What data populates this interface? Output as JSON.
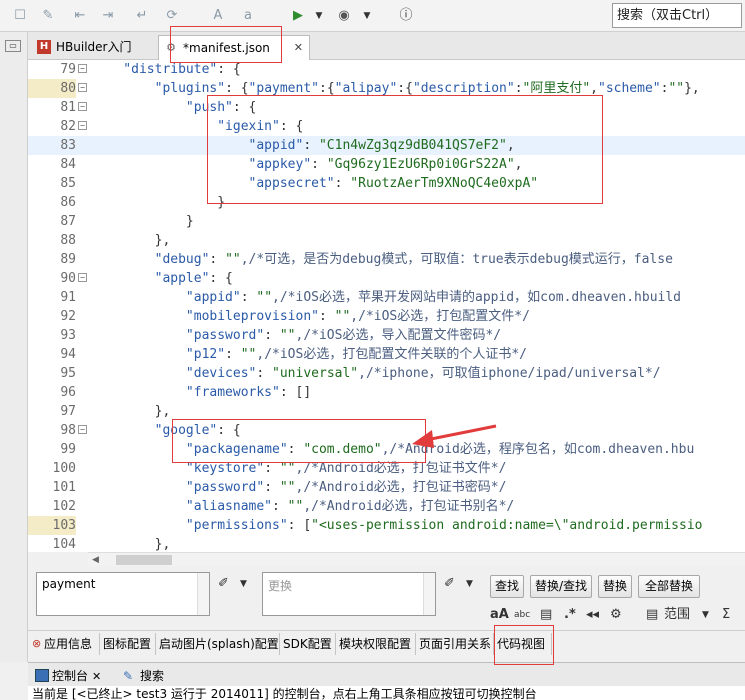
{
  "search": {
    "placeholder": "搜索（双击Ctrl）"
  },
  "tabs": [
    {
      "label": "HBuilder入门",
      "icon": "hbuilder-logo-icon",
      "icon_text": "H"
    },
    {
      "label": "*manifest.json",
      "icon": "gear-icon",
      "icon_text": "⚙",
      "close": "✕"
    }
  ],
  "lines": [
    {
      "num": "79",
      "fold": true,
      "segs": [
        {
          "t": "    \"distribute\"",
          "c": "k"
        },
        {
          "t": ": {",
          "c": "p"
        }
      ]
    },
    {
      "num": "80",
      "fold": true,
      "current": true,
      "segs": [
        {
          "t": "        \"plugins\"",
          "c": "k"
        },
        {
          "t": ": {",
          "c": "p"
        },
        {
          "t": "\"payment\"",
          "c": "k"
        },
        {
          "t": ":{",
          "c": "p"
        },
        {
          "t": "\"alipay\"",
          "c": "k"
        },
        {
          "t": ":{",
          "c": "p"
        },
        {
          "t": "\"description\"",
          "c": "k"
        },
        {
          "t": ":",
          "c": "p"
        },
        {
          "t": "\"阿里支付\"",
          "c": "s"
        },
        {
          "t": ",",
          "c": "p"
        },
        {
          "t": "\"scheme\"",
          "c": "k"
        },
        {
          "t": ":",
          "c": "p"
        },
        {
          "t": "\"\"",
          "c": "s"
        },
        {
          "t": "},",
          "c": "p"
        }
      ]
    },
    {
      "num": "81",
      "fold": true,
      "segs": [
        {
          "t": "            \"push\"",
          "c": "k"
        },
        {
          "t": ": {",
          "c": "p"
        }
      ]
    },
    {
      "num": "82",
      "fold": true,
      "segs": [
        {
          "t": "                \"igexin\"",
          "c": "k"
        },
        {
          "t": ": {",
          "c": "p"
        }
      ]
    },
    {
      "num": "83",
      "highlight": true,
      "segs": [
        {
          "t": "                    \"appid\"",
          "c": "k"
        },
        {
          "t": ": ",
          "c": "p"
        },
        {
          "t": "\"C1n4wZg3qz9dB041QS7eF2\"",
          "c": "s"
        },
        {
          "t": ",",
          "c": "p"
        }
      ]
    },
    {
      "num": "84",
      "segs": [
        {
          "t": "                    \"appkey\"",
          "c": "k"
        },
        {
          "t": ": ",
          "c": "p"
        },
        {
          "t": "\"Gq96zy1EzU6Rp0i0GrS22A\"",
          "c": "s"
        },
        {
          "t": ",",
          "c": "p"
        }
      ]
    },
    {
      "num": "85",
      "segs": [
        {
          "t": "                    \"appsecret\"",
          "c": "k"
        },
        {
          "t": ": ",
          "c": "p"
        },
        {
          "t": "\"RuotzAerTm9XNoQC4e0xpA\"",
          "c": "s"
        }
      ]
    },
    {
      "num": "86",
      "segs": [
        {
          "t": "                }",
          "c": "p"
        }
      ]
    },
    {
      "num": "87",
      "segs": [
        {
          "t": "            }",
          "c": "p"
        }
      ]
    },
    {
      "num": "88",
      "segs": [
        {
          "t": "        },",
          "c": "p"
        }
      ]
    },
    {
      "num": "89",
      "segs": [
        {
          "t": "        \"debug\"",
          "c": "k"
        },
        {
          "t": ": ",
          "c": "p"
        },
        {
          "t": "\"\"",
          "c": "s"
        },
        {
          "t": ",/*可选，是否为debug模式，可取值：true表示debug模式运行，false",
          "c": "c"
        }
      ]
    },
    {
      "num": "90",
      "fold": true,
      "segs": [
        {
          "t": "        \"apple\"",
          "c": "k"
        },
        {
          "t": ": {",
          "c": "p"
        }
      ]
    },
    {
      "num": "91",
      "segs": [
        {
          "t": "            \"appid\"",
          "c": "k"
        },
        {
          "t": ": ",
          "c": "p"
        },
        {
          "t": "\"\"",
          "c": "s"
        },
        {
          "t": ",/*iOS必选，苹果开发网站申请的appid，如com.dheaven.hbuild",
          "c": "c"
        }
      ]
    },
    {
      "num": "92",
      "segs": [
        {
          "t": "            \"mobileprovision\"",
          "c": "k"
        },
        {
          "t": ": ",
          "c": "p"
        },
        {
          "t": "\"\"",
          "c": "s"
        },
        {
          "t": ",/*iOS必选，打包配置文件*/",
          "c": "c"
        }
      ]
    },
    {
      "num": "93",
      "segs": [
        {
          "t": "            \"password\"",
          "c": "k"
        },
        {
          "t": ": ",
          "c": "p"
        },
        {
          "t": "\"\"",
          "c": "s"
        },
        {
          "t": ",/*iOS必选，导入配置文件密码*/",
          "c": "c"
        }
      ]
    },
    {
      "num": "94",
      "segs": [
        {
          "t": "            \"p12\"",
          "c": "k"
        },
        {
          "t": ": ",
          "c": "p"
        },
        {
          "t": "\"\"",
          "c": "s"
        },
        {
          "t": ",/*iOS必选，打包配置文件关联的个人证书*/",
          "c": "c"
        }
      ]
    },
    {
      "num": "95",
      "segs": [
        {
          "t": "            \"devices\"",
          "c": "k"
        },
        {
          "t": ": ",
          "c": "p"
        },
        {
          "t": "\"universal\"",
          "c": "s"
        },
        {
          "t": ",/*iphone，可取值iphone/ipad/universal*/",
          "c": "c"
        }
      ]
    },
    {
      "num": "96",
      "segs": [
        {
          "t": "            \"frameworks\"",
          "c": "k"
        },
        {
          "t": ": []",
          "c": "p"
        }
      ]
    },
    {
      "num": "97",
      "segs": [
        {
          "t": "        },",
          "c": "p"
        }
      ]
    },
    {
      "num": "98",
      "fold": true,
      "segs": [
        {
          "t": "        \"google\"",
          "c": "k"
        },
        {
          "t": ": {",
          "c": "p"
        }
      ]
    },
    {
      "num": "99",
      "segs": [
        {
          "t": "            \"packagename\"",
          "c": "k"
        },
        {
          "t": ": ",
          "c": "p"
        },
        {
          "t": "\"com.demo\"",
          "c": "s"
        },
        {
          "t": ",/*Android必选，程序包名，如com.dheaven.hbu",
          "c": "c"
        }
      ]
    },
    {
      "num": "100",
      "segs": [
        {
          "t": "            \"keystore\"",
          "c": "k"
        },
        {
          "t": ": ",
          "c": "p"
        },
        {
          "t": "\"\"",
          "c": "s"
        },
        {
          "t": ",/*Android必选，打包证书文件*/",
          "c": "c"
        }
      ]
    },
    {
      "num": "101",
      "segs": [
        {
          "t": "            \"password\"",
          "c": "k"
        },
        {
          "t": ": ",
          "c": "p"
        },
        {
          "t": "\"\"",
          "c": "s"
        },
        {
          "t": ",/*Android必选，打包证书密码*/",
          "c": "c"
        }
      ]
    },
    {
      "num": "102",
      "segs": [
        {
          "t": "            \"aliasname\"",
          "c": "k"
        },
        {
          "t": ": ",
          "c": "p"
        },
        {
          "t": "\"\"",
          "c": "s"
        },
        {
          "t": ",/*Android必选，打包证书别名*/",
          "c": "c"
        }
      ]
    },
    {
      "num": "103",
      "current": true,
      "segs": [
        {
          "t": "            \"permissions\"",
          "c": "k"
        },
        {
          "t": ": [",
          "c": "p"
        },
        {
          "t": "\"<uses-permission android:name=\\\"android.permissio",
          "c": "s"
        }
      ]
    },
    {
      "num": "104",
      "segs": [
        {
          "t": "        },",
          "c": "p"
        }
      ]
    }
  ],
  "find": {
    "find_value": "payment",
    "replace_placeholder": "更换",
    "buttons": [
      "查找",
      "替换/查找",
      "替换",
      "全部替换"
    ],
    "options": {
      "case": "aA",
      "word": "abc",
      "regex": ".*",
      "back": "◂◂",
      "settings": "⚙",
      "scope": "范围",
      "sigma": "Σ"
    }
  },
  "bottom_tabs": [
    "应用信息",
    "图标配置",
    "启动图片(splash)配置",
    "SDK配置",
    "模块权限配置",
    "页面引用关系",
    "代码视图"
  ],
  "console_tabs": [
    {
      "label": "控制台",
      "close": "✕"
    },
    {
      "label": "搜索"
    }
  ],
  "status_text": "当前是 [<已终止> test3 运行于 2014011] 的控制台，点右上角工具条相应按钮可切换控制台",
  "colors": {
    "annotation_red": "#e23b3b",
    "key_blue": "#2a5aa8",
    "string_green": "#1f6b1f"
  }
}
